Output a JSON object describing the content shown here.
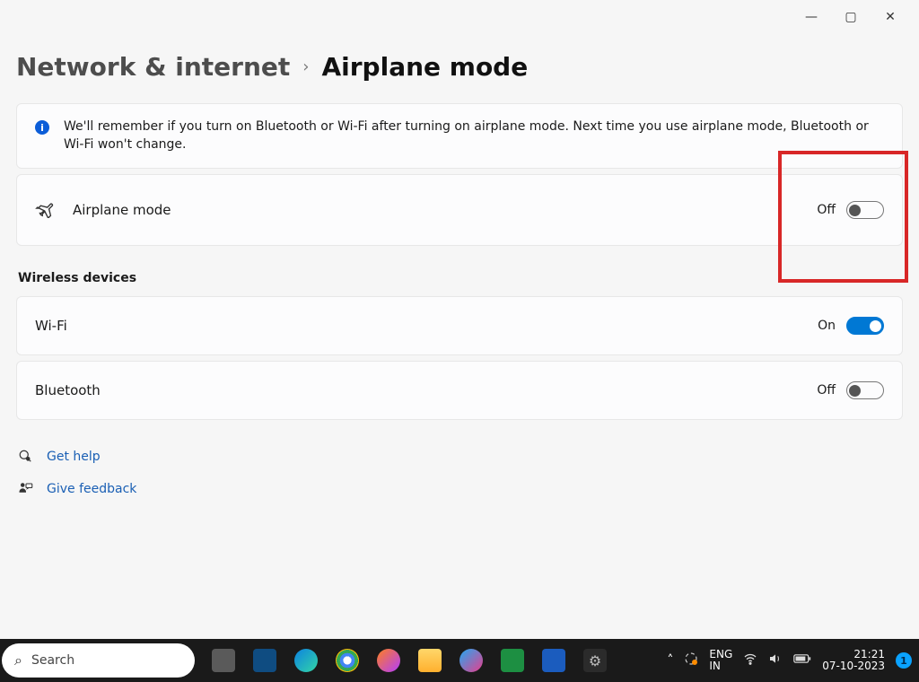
{
  "window_controls": {
    "minimize": "—",
    "restore": "▢",
    "close": "✕"
  },
  "breadcrumb": {
    "parent": "Network & internet",
    "separator": "›",
    "current": "Airplane mode"
  },
  "info_banner": {
    "text": "We'll remember if you turn on Bluetooth or Wi-Fi after turning on airplane mode. Next time you use airplane mode, Bluetooth or Wi-Fi won't change."
  },
  "airplane_toggle": {
    "label": "Airplane mode",
    "state": "Off",
    "on": false
  },
  "section_title": "Wireless devices",
  "wifi_toggle": {
    "label": "Wi-Fi",
    "state": "On",
    "on": true
  },
  "bluetooth_toggle": {
    "label": "Bluetooth",
    "state": "Off",
    "on": false
  },
  "links": {
    "help": "Get help",
    "feedback": "Give feedback"
  },
  "taskbar": {
    "search_placeholder": "Search",
    "lang_line1": "ENG",
    "lang_line2": "IN",
    "time": "21:21",
    "date": "07-10-2023",
    "notif_count": "1"
  }
}
